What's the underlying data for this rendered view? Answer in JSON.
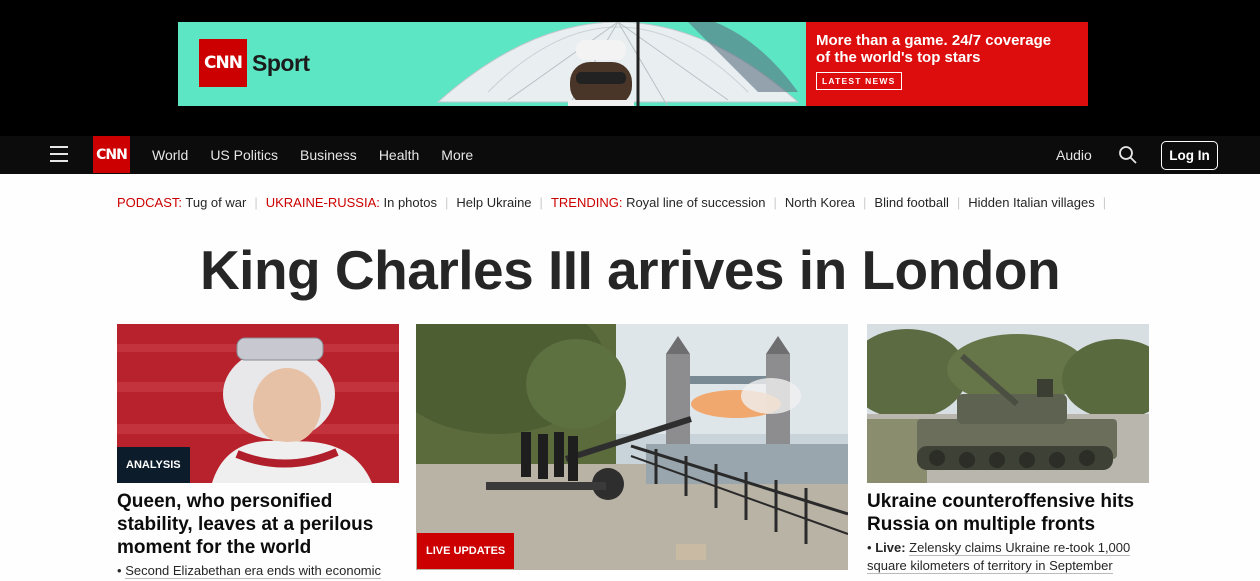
{
  "ad": {
    "brand": "CNN",
    "section": "Sport",
    "headline_line1": "More than a game. 24/7 coverage",
    "headline_line2": "of the world's top stars",
    "button": "LATEST NEWS",
    "colors": {
      "left_bg": "#5ce6c4",
      "right_bg": "#dd0d0d"
    }
  },
  "nav": {
    "logo": "CNN",
    "links": [
      "World",
      "US Politics",
      "Business",
      "Health",
      "More"
    ],
    "audio": "Audio",
    "login": "Log In",
    "search_icon": "search-icon",
    "menu_icon": "hamburger-icon"
  },
  "trending": [
    {
      "prefix": "PODCAST:",
      "text": "Tug of war"
    },
    {
      "prefix": "UKRAINE-RUSSIA:",
      "text": "In photos"
    },
    {
      "prefix": "",
      "text": "Help Ukraine"
    },
    {
      "prefix": "TRENDING:",
      "text": "Royal line of succession"
    },
    {
      "prefix": "",
      "text": "North Korea"
    },
    {
      "prefix": "",
      "text": "Blind football"
    },
    {
      "prefix": "",
      "text": "Hidden Italian villages"
    }
  ],
  "headline": "King Charles III arrives in London",
  "cards": {
    "left": {
      "label": "ANALYSIS",
      "title": "Queen, who personified stability, leaves at a perilous moment for the world",
      "sub_bullet": "•",
      "sub": "Second Elizabethan era ends with economic"
    },
    "center": {
      "label": "LIVE UPDATES"
    },
    "right": {
      "title": "Ukraine counteroffensive hits Russia on multiple fronts",
      "sub_bullet": "•",
      "sub_prefix": "Live:",
      "sub": "Zelensky claims Ukraine re-took 1,000 square kilometers of territory in September"
    }
  },
  "colors": {
    "accent": "#cc0000",
    "nav_bg": "#0c0c0c",
    "analysis_bg": "#0c1c2b"
  }
}
